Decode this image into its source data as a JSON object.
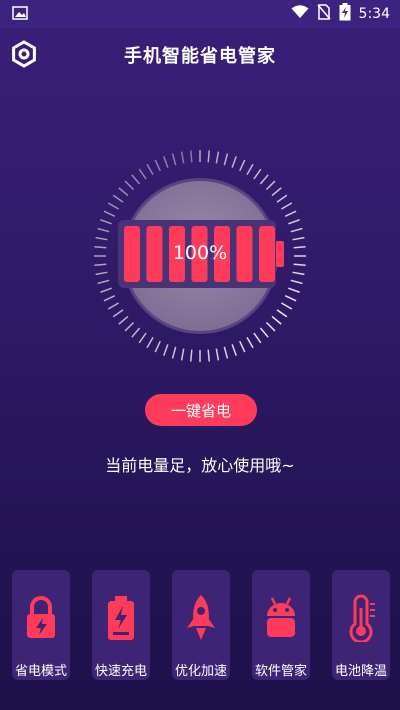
{
  "status_bar": {
    "time": "5:34",
    "icons": [
      "image-icon",
      "wifi-icon",
      "no-sim-icon",
      "battery-charging-icon"
    ]
  },
  "header": {
    "title": "手机智能省电管家",
    "settings_icon": "hexagon-gear-icon"
  },
  "battery": {
    "percent_text": "100%",
    "level": 1.0,
    "accent_color": "#ff3b5c"
  },
  "actions": {
    "save_label": "一键省电"
  },
  "message": {
    "text": "当前电量足，放心使用哦~"
  },
  "tools": [
    {
      "label": "省电模式",
      "icon": "lock-lightning-icon"
    },
    {
      "label": "快速充电",
      "icon": "battery-charge-icon"
    },
    {
      "label": "优化加速",
      "icon": "rocket-icon"
    },
    {
      "label": "软件管家",
      "icon": "android-icon"
    },
    {
      "label": "电池降温",
      "icon": "thermometer-icon"
    }
  ]
}
